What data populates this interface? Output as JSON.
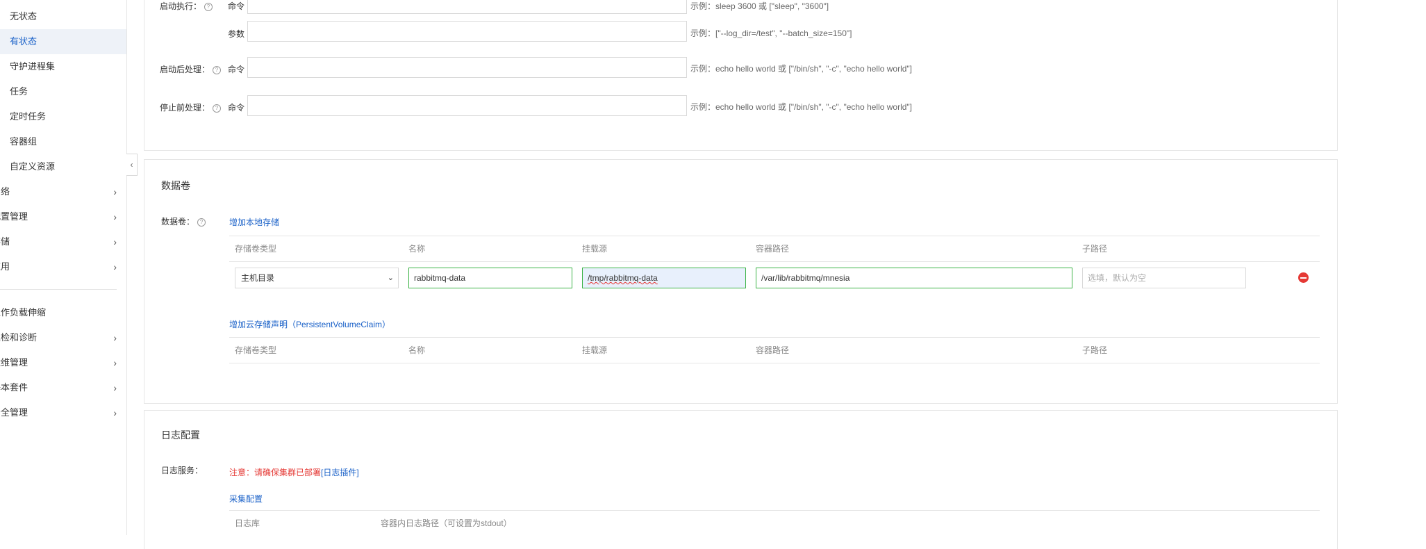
{
  "sidebar": {
    "items": [
      {
        "label": "无状态",
        "top": false,
        "active": false
      },
      {
        "label": "有状态",
        "top": false,
        "active": true
      },
      {
        "label": "守护进程集",
        "top": false,
        "active": false
      },
      {
        "label": "任务",
        "top": false,
        "active": false
      },
      {
        "label": "定时任务",
        "top": false,
        "active": false
      },
      {
        "label": "容器组",
        "top": false,
        "active": false
      },
      {
        "label": "自定义资源",
        "top": false,
        "active": false
      },
      {
        "label": "网络",
        "top": true,
        "active": false
      },
      {
        "label": "配置管理",
        "top": true,
        "active": false
      },
      {
        "label": "存储",
        "top": true,
        "active": false
      },
      {
        "label": "应用",
        "top": true,
        "active": false
      },
      {
        "label": "工作负载伸缩",
        "top": true,
        "active": false
      },
      {
        "label": "巡检和诊断",
        "top": true,
        "active": false
      },
      {
        "label": "运维管理",
        "top": true,
        "active": false
      },
      {
        "label": "基本套件",
        "top": true,
        "active": false
      },
      {
        "label": "安全管理",
        "top": true,
        "active": false
      }
    ],
    "collapse_glyph": "‹"
  },
  "lifecycle": {
    "start_label": "启动执行：",
    "command_label": "命令",
    "args_label": "参数",
    "poststart_label": "启动后处理：",
    "prestop_label": "停止前处理：",
    "start_cmd_hint": "示例：sleep 3600 或 [\"sleep\", \"3600\"]",
    "start_args_hint": "示例：[\"--log_dir=/test\", \"--batch_size=150\"]",
    "poststart_hint": "示例：echo hello world 或 [\"/bin/sh\", \"-c\", \"echo hello world\"]",
    "prestop_hint": "示例：echo hello world 或 [\"/bin/sh\", \"-c\", \"echo hello world\"]",
    "start_cmd_value": "",
    "start_args_value": "",
    "poststart_value": "",
    "prestop_value": ""
  },
  "volumes": {
    "section_title": "数据卷",
    "field_label": "数据卷：",
    "add_local": "增加本地存储",
    "add_pvc": "增加云存储声明（PersistentVolumeClaim）",
    "columns": [
      "存储卷类型",
      "名称",
      "挂载源",
      "容器路径",
      "子路径"
    ],
    "local_row": {
      "type": "主机目录",
      "name": "rabbitmq-data",
      "source": "/tmp/rabbitmq-data",
      "container_path": "/var/lib/rabbitmq/mnesia",
      "subpath_placeholder": "选填，默认为空"
    },
    "pvc_columns": [
      "存储卷类型",
      "名称",
      "挂载源",
      "容器路径",
      "子路径"
    ]
  },
  "logging": {
    "section_title": "日志配置",
    "service_label": "日志服务：",
    "warning_prefix": "注意：请确保集群已部署",
    "warning_link": "[日志插件]",
    "collect_link": "采集配置",
    "columns": [
      "日志库",
      "容器内日志路径（可设置为stdout）"
    ]
  },
  "icons": {
    "help": "question-circle-icon",
    "chevron": "chevron-right-icon",
    "remove": "minus-circle-icon",
    "dropdown": "chevron-down-icon"
  },
  "colors": {
    "accent": "#1a61c8",
    "valid_border": "#3bb346",
    "danger": "#e53935"
  }
}
